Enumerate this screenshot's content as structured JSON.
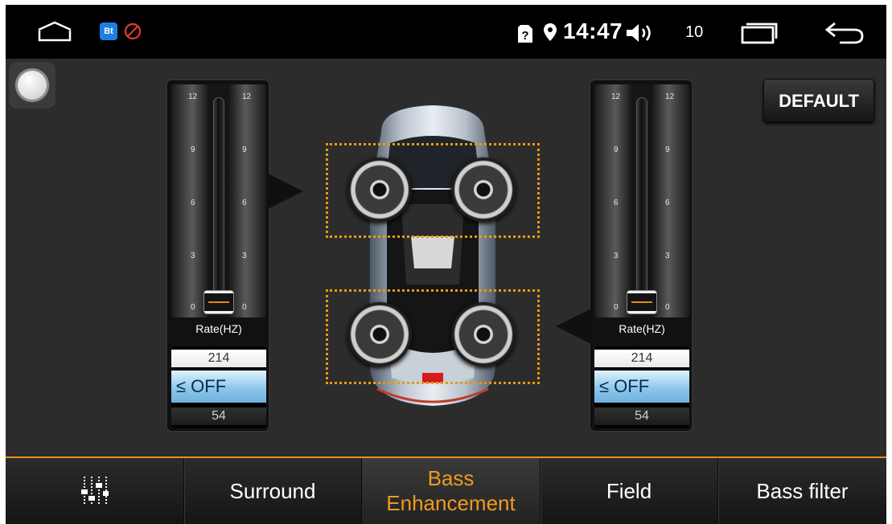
{
  "status_bar": {
    "clock": "14:47",
    "volume_level": "10",
    "icons": [
      "home-icon",
      "app-icon",
      "blocked-icon",
      "sim-alert-icon",
      "location-icon",
      "volume-icon",
      "recents-icon",
      "back-icon"
    ],
    "app_icon_text": "Bt"
  },
  "default_button": {
    "label": "DEFAULT"
  },
  "left_slider": {
    "ticks": [
      "12",
      "9",
      "6",
      "3",
      "0"
    ],
    "value": 0,
    "range": [
      0,
      12
    ],
    "rate_label": "Rate(HZ)",
    "picker": {
      "above": "214",
      "selected": "≤ OFF",
      "below": "54"
    }
  },
  "right_slider": {
    "ticks": [
      "12",
      "9",
      "6",
      "3",
      "0"
    ],
    "value": 0,
    "range": [
      0,
      12
    ],
    "rate_label": "Rate(HZ)",
    "picker": {
      "above": "214",
      "selected": "≤ OFF",
      "below": "54"
    }
  },
  "tabs": [
    {
      "label": "",
      "icon": "equalizer-icon",
      "active": false
    },
    {
      "label": "Surround",
      "active": false
    },
    {
      "label_line1": "Bass",
      "label_line2": "Enhancement",
      "active": true
    },
    {
      "label": "Field",
      "active": false
    },
    {
      "label": "Bass filter",
      "active": false
    }
  ],
  "colors": {
    "accent": "#f09a1f",
    "background": "#2c2c2c",
    "picker_selected": "#8ec7ea"
  }
}
